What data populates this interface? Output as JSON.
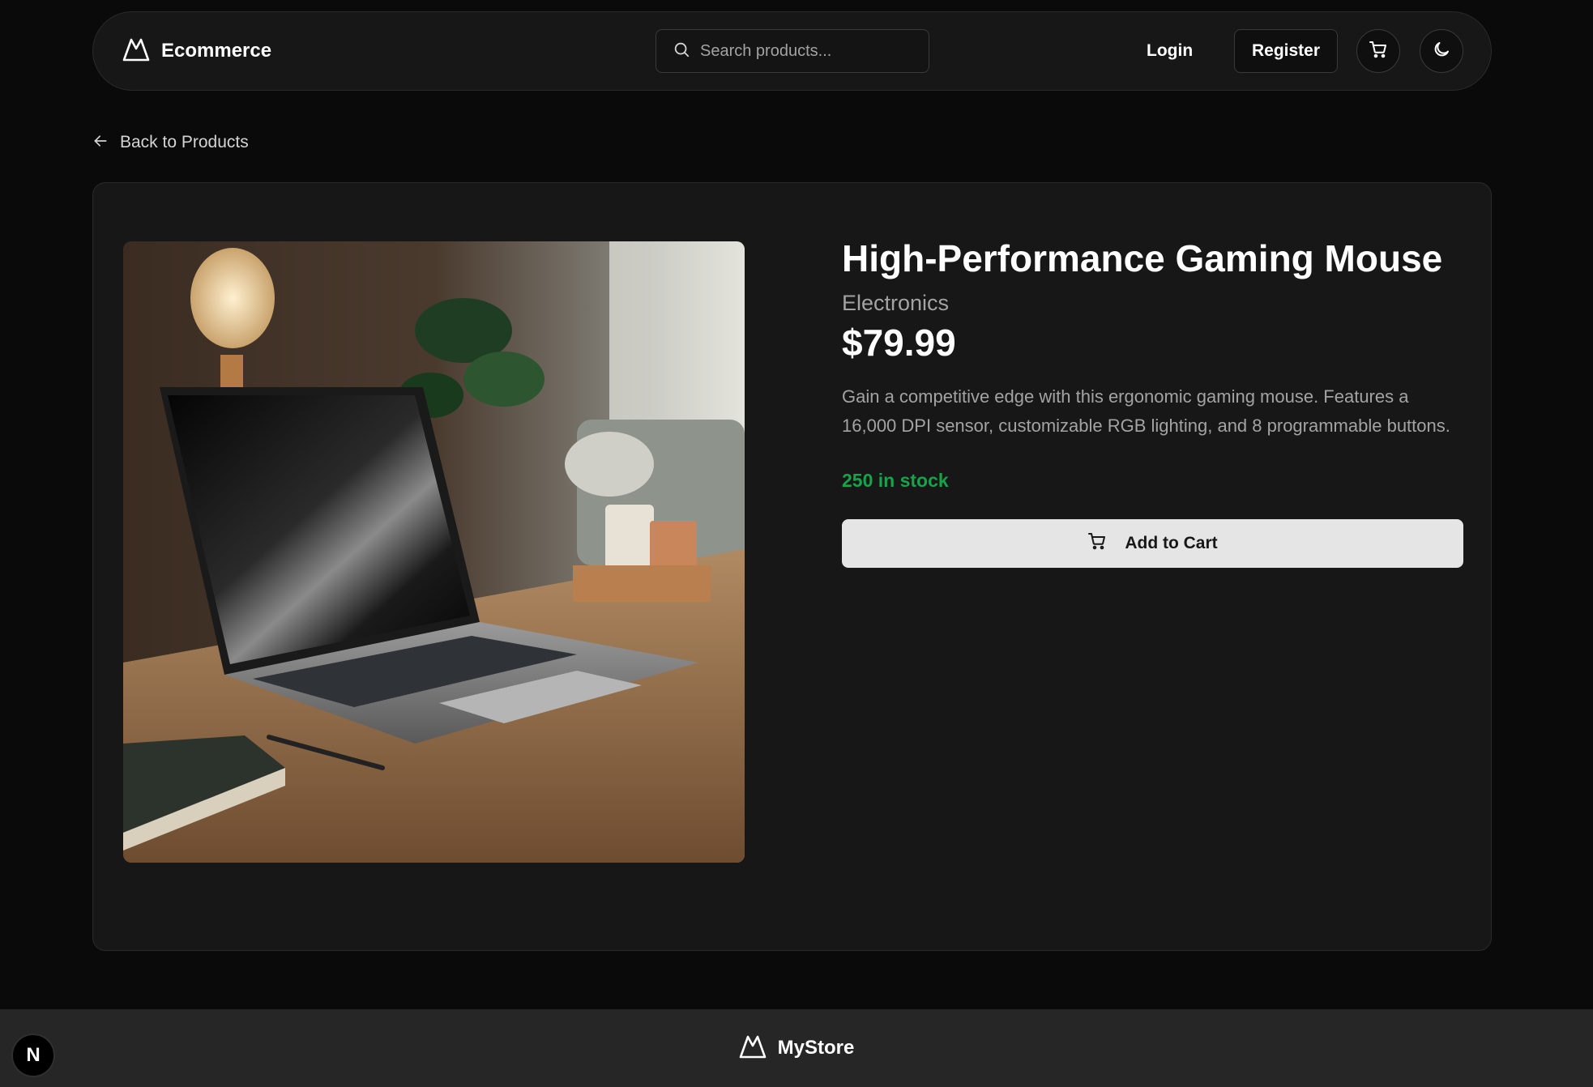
{
  "header": {
    "brand": "Ecommerce",
    "search_placeholder": "Search products...",
    "login_label": "Login",
    "register_label": "Register",
    "icons": [
      "logo-icon",
      "search-icon",
      "cart-icon",
      "moon-icon"
    ]
  },
  "back_link": {
    "label": "Back to Products",
    "icon": "arrow-left-icon"
  },
  "product": {
    "title": "High-Performance Gaming Mouse",
    "category": "Electronics",
    "price": "$79.99",
    "description": "Gain a competitive edge with this ergonomic gaming mouse. Features a 16,000 DPI sensor, customizable RGB lighting, and 8 programmable buttons.",
    "stock": "250 in stock",
    "add_to_cart_label": "Add to Cart",
    "image_alt": "Laptop on wooden desk"
  },
  "footer": {
    "brand": "MyStore"
  },
  "dev_badge": {
    "label": "N"
  },
  "colors": {
    "background": "#0a0a0a",
    "card": "#171717",
    "accent_stock": "#16a34a",
    "button_light": "#e5e5e5",
    "footer": "#262626"
  }
}
